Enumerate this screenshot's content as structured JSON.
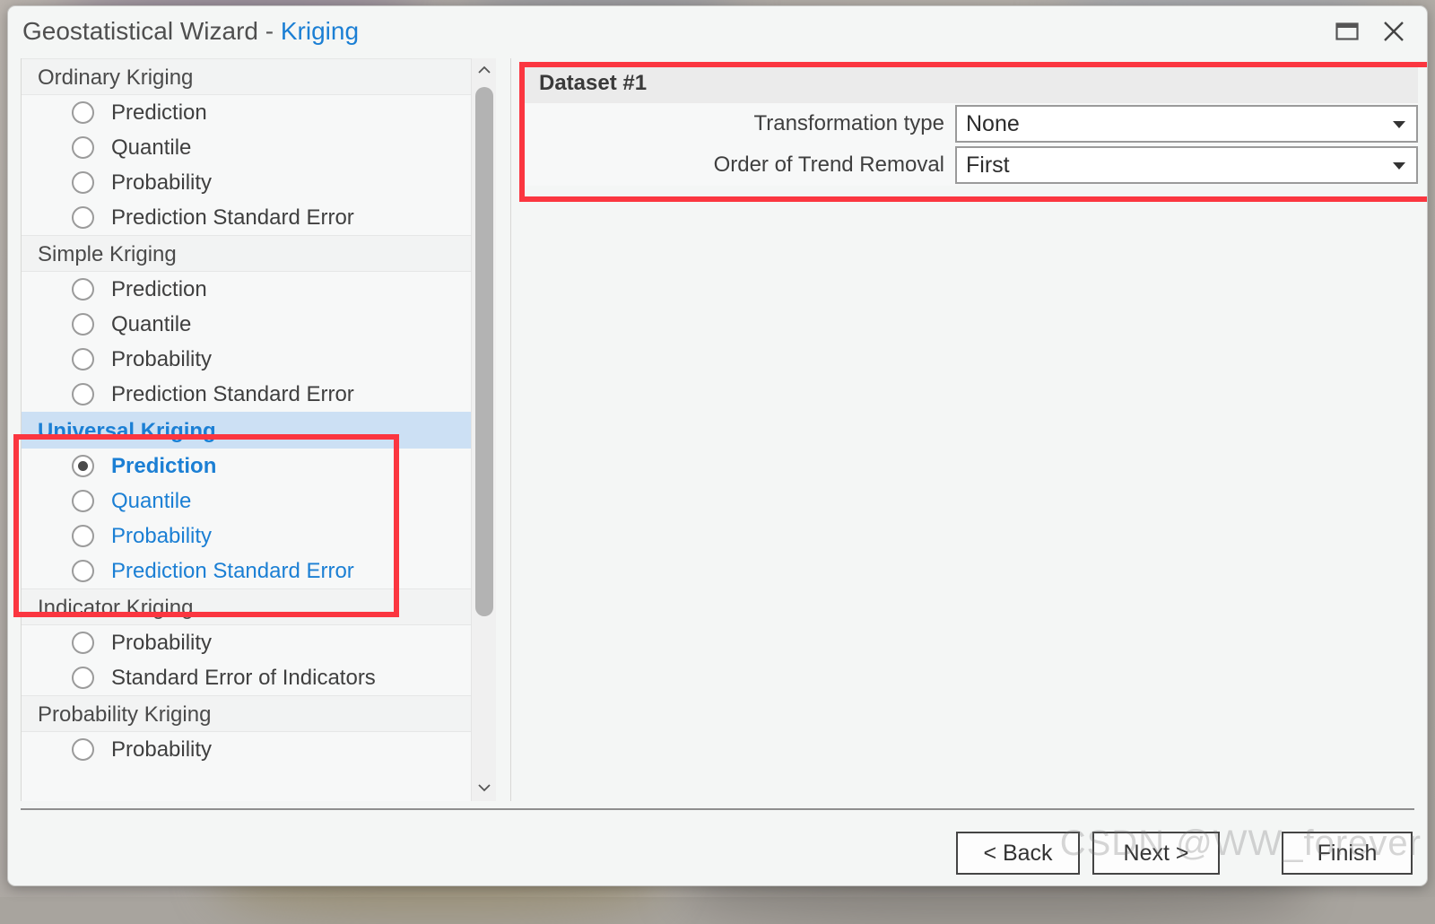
{
  "window": {
    "title_main": "Geostatistical Wizard",
    "title_separator": "-",
    "title_accent": "Kriging",
    "restore_icon": "restore-window-icon",
    "close_icon": "close-icon"
  },
  "method_list": {
    "scrollbar": {
      "up_icon": "chevron-up-icon",
      "down_icon": "chevron-down-icon"
    },
    "groups": [
      {
        "label": "Ordinary Kriging",
        "selected": false,
        "options": [
          {
            "label": "Prediction",
            "checked": false
          },
          {
            "label": "Quantile",
            "checked": false
          },
          {
            "label": "Probability",
            "checked": false
          },
          {
            "label": "Prediction Standard Error",
            "checked": false
          }
        ]
      },
      {
        "label": "Simple Kriging",
        "selected": false,
        "options": [
          {
            "label": "Prediction",
            "checked": false
          },
          {
            "label": "Quantile",
            "checked": false
          },
          {
            "label": "Probability",
            "checked": false
          },
          {
            "label": "Prediction Standard Error",
            "checked": false
          }
        ]
      },
      {
        "label": "Universal Kriging",
        "selected": true,
        "options": [
          {
            "label": "Prediction",
            "checked": true
          },
          {
            "label": "Quantile",
            "checked": false
          },
          {
            "label": "Probability",
            "checked": false
          },
          {
            "label": "Prediction Standard Error",
            "checked": false
          }
        ]
      },
      {
        "label": "Indicator Kriging",
        "selected": false,
        "options": [
          {
            "label": "Probability",
            "checked": false
          },
          {
            "label": "Standard Error of Indicators",
            "checked": false
          }
        ]
      },
      {
        "label": "Probability Kriging",
        "selected": false,
        "options": [
          {
            "label": "Probability",
            "checked": false
          }
        ]
      }
    ]
  },
  "properties": {
    "header": "Dataset #1",
    "rows": [
      {
        "label": "Transformation type",
        "value": "None",
        "caret_icon": "chevron-down-icon"
      },
      {
        "label": "Order of Trend Removal",
        "value": "First",
        "caret_icon": "chevron-down-icon"
      }
    ]
  },
  "footer": {
    "back_label": "< Back",
    "next_label": "Next >",
    "finish_label": "Finish"
  },
  "watermark": "CSDN @WW_forever",
  "colors": {
    "accent_blue": "#1b7fd4",
    "selection_blue": "#cce0f4",
    "annotation_red": "#fb3640",
    "window_bg": "#f4f6f5",
    "group_header_bg": "#f2f3f3"
  }
}
